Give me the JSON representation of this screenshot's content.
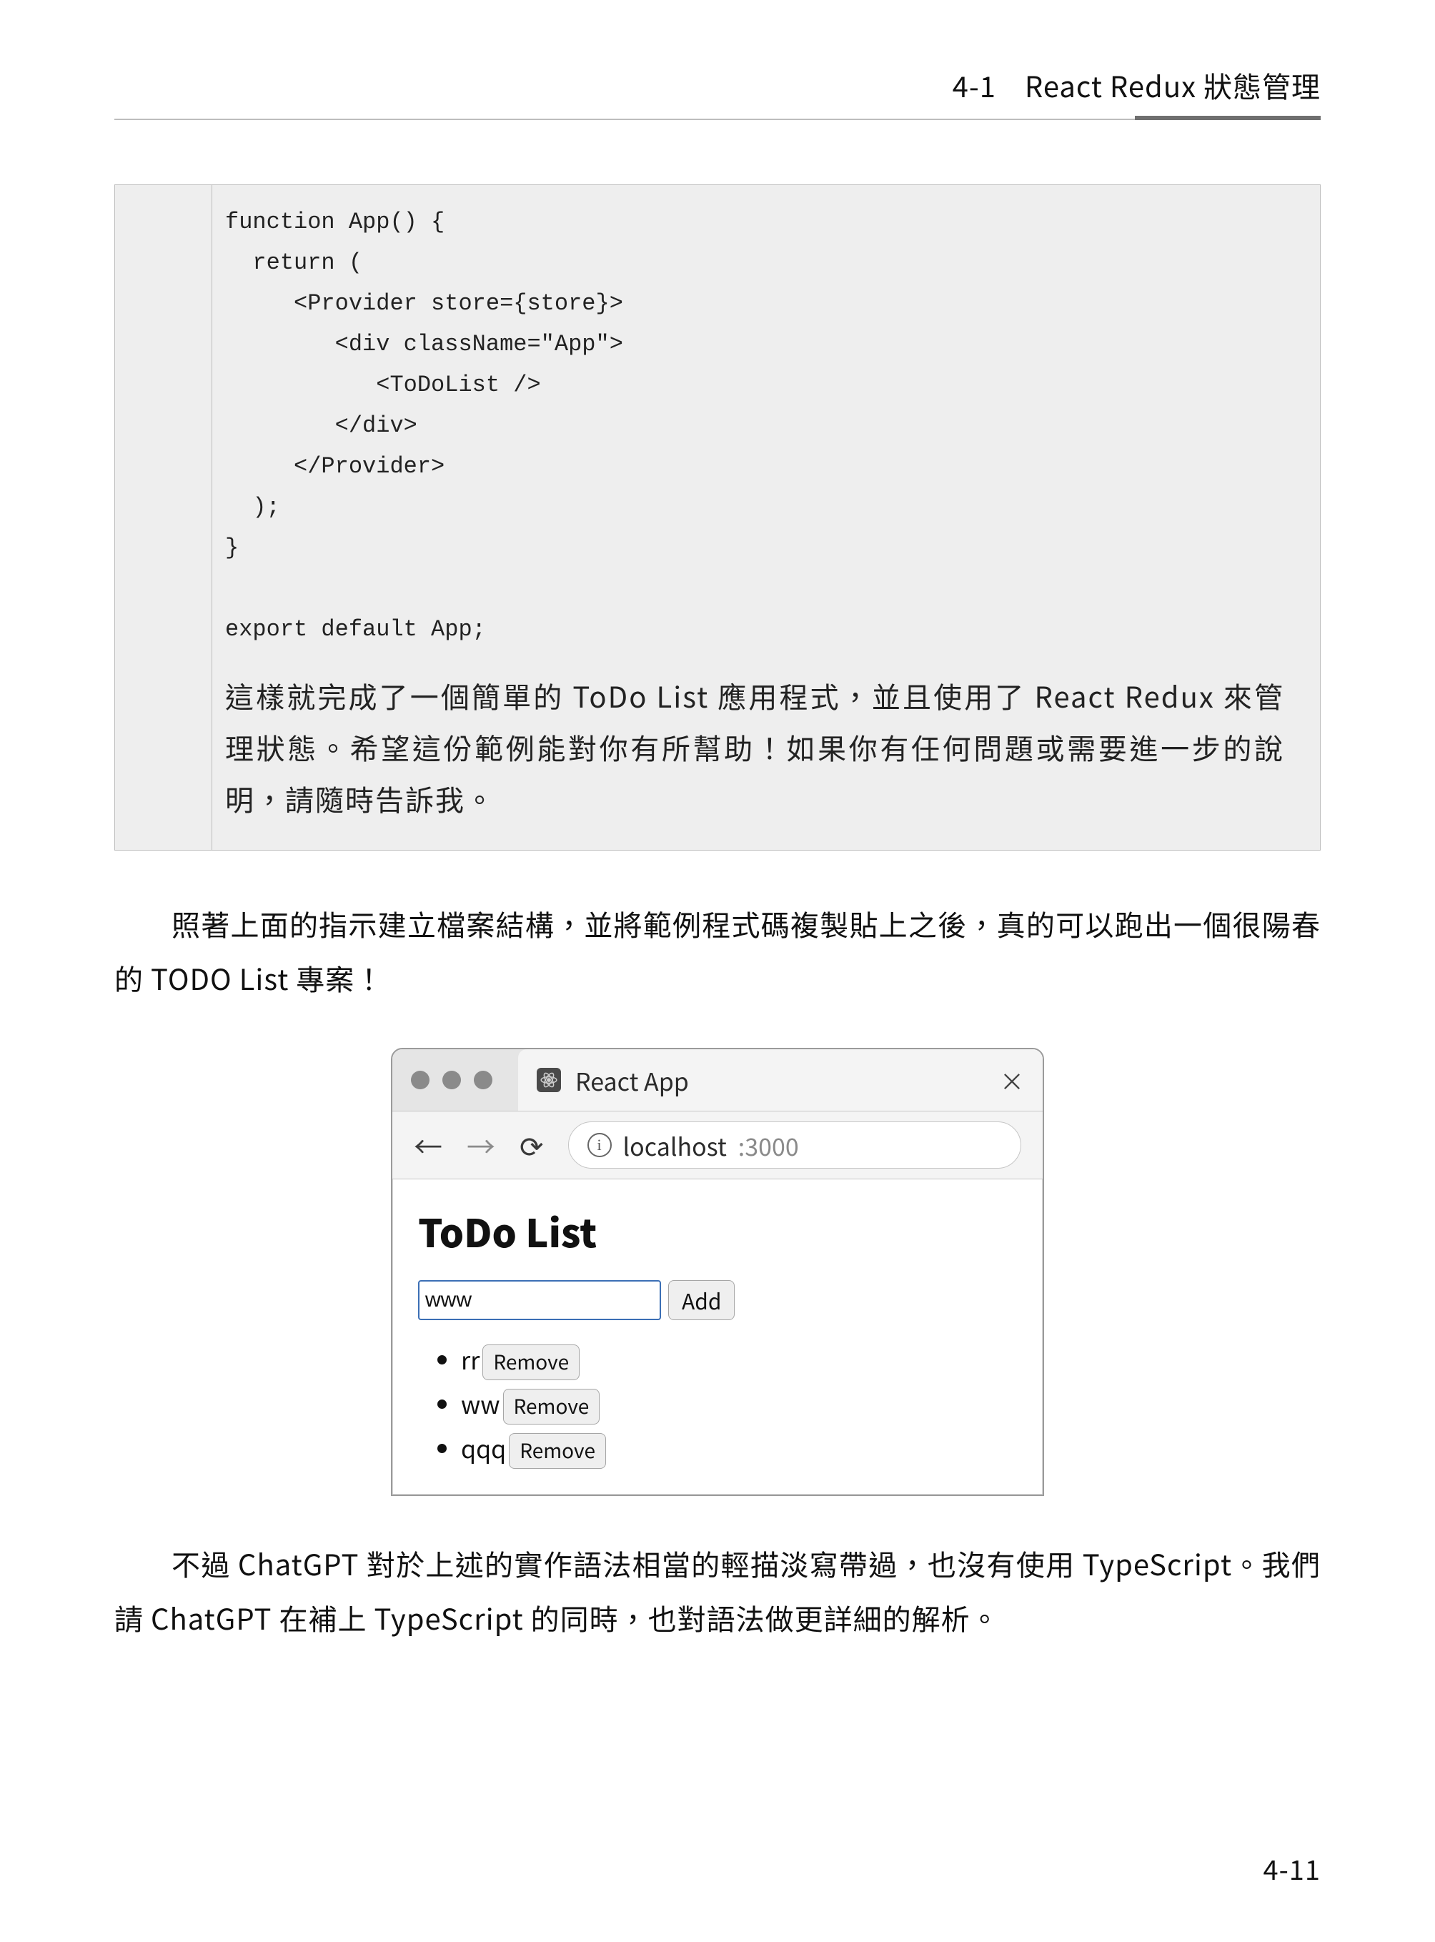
{
  "header": {
    "section": "4-1",
    "title": "React Redux 狀態管理"
  },
  "code": "function App() {\n  return (\n     <Provider store={store}>\n        <div className=\"App\">\n           <ToDoList />\n        </div>\n     </Provider>\n  );\n}\n\nexport default App;",
  "box_desc": "這樣就完成了一個簡單的 ToDo List 應用程式，並且使用了 React Redux 來管理狀態。希望這份範例能對你有所幫助！如果你有任何問題或需要進一步的說明，請隨時告訴我。",
  "para1": "照著上面的指示建立檔案結構，並將範例程式碼複製貼上之後，真的可以跑出一個很陽春的 TODO List 專案！",
  "browser": {
    "tab_title": "React App",
    "url_host": "localhost",
    "url_rest": ":3000",
    "heading": "ToDo List",
    "input_value": "www",
    "add_label": "Add",
    "remove_label": "Remove",
    "items": [
      "rr",
      "ww",
      "qqq"
    ]
  },
  "para2": "不過 ChatGPT 對於上述的實作語法相當的輕描淡寫帶過，也沒有使用 TypeScript。我們請 ChatGPT 在補上 TypeScript 的同時，也對語法做更詳細的解析。",
  "page_number": "4-11"
}
